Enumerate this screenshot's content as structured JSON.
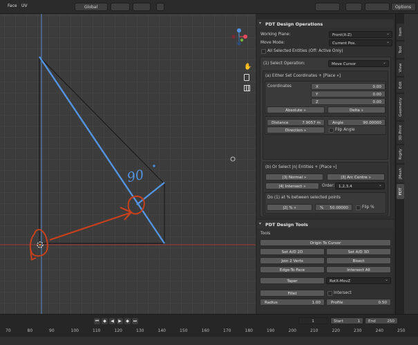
{
  "topbar": {
    "menu_face": "Face",
    "menu_uv": "UV",
    "orientation": "Global",
    "options": "Options"
  },
  "viewport": {
    "annotation": "90"
  },
  "pdt_ops": {
    "title": "PDT Design Operations",
    "working_plane_label": "Working Plane:",
    "working_plane_value": "Front(X-Z)",
    "move_mode_label": "Move Mode:",
    "move_mode_value": "Current Pos.",
    "all_selected_label": "All Selected Entities (Off: Active Only)",
    "select_op_label": "(1) Select Operation:",
    "select_op_value": "Move Cursor",
    "either_set_label": "(a) Either Set Coordinates + [Place »]",
    "coordinates_label": "Coordinates",
    "x_label": "X",
    "x_value": "0.00",
    "y_label": "Y",
    "y_value": "0.00",
    "z_label": "Z",
    "z_value": "0.00",
    "absolute_button": "Absolute »",
    "delta_button": "Delta »",
    "distance_label": "Distance",
    "distance_value": "7.9057 m",
    "angle_label": "Angle",
    "angle_value": "90.00000",
    "direction_button": "Direction »",
    "flip_angle_label": "Flip Angle",
    "or_select_label": "(b) Or Select |n| Entities + [Place »]",
    "normal_button": "|3| Normal »",
    "arc_centre_button": "|3| Arc Centre »",
    "intersect_button": "|4| Intersect »",
    "order_label": "Order:",
    "order_value": "1,2,3,4",
    "do_percent_label": "Do (1) at % between selected points",
    "percent_button": "|2| % »",
    "percent_sign": "%",
    "percent_value": "50.00000",
    "flip_percent_label": "Flip %"
  },
  "pdt_tools": {
    "title": "PDT Design Tools",
    "tools_label": "Tools",
    "origin_to_cursor": "Origin To Cursor",
    "set_ad_2d": "Set A/D 2D",
    "set_ad_3d": "Set A/D 3D",
    "join_2_verts": "Join 2 Verts",
    "bisect": "Bisect",
    "edge_to_face": "Edge-To-Face",
    "intersect_all": "Intersect All",
    "taper": "Taper",
    "taper_axis": "RotX-MovZ",
    "fillet": "Fillet",
    "intersect_label": "Intersect",
    "radius_label": "Radius",
    "radius_value": "1.00",
    "profile_label": "Profile",
    "profile_value": "0.50"
  },
  "side_tabs": [
    "Item",
    "Tool",
    "View",
    "Edit",
    "Geometry",
    "3D-Print",
    "Rigify",
    "JMesh",
    "PDT"
  ],
  "timeline": {
    "ticks": [
      "70",
      "80",
      "90",
      "100",
      "110",
      "120",
      "130",
      "140",
      "150",
      "160",
      "170",
      "180",
      "190",
      "200",
      "210",
      "220",
      "230",
      "240",
      "250"
    ],
    "current_frame": "1",
    "start_label": "Start",
    "start_value": "1",
    "end_label": "End",
    "end_value": "250"
  },
  "colors": {
    "accent_blue": "#5294e2",
    "orange_ink": "#c8401c",
    "panel_bg": "#303030",
    "button": "#585858"
  }
}
